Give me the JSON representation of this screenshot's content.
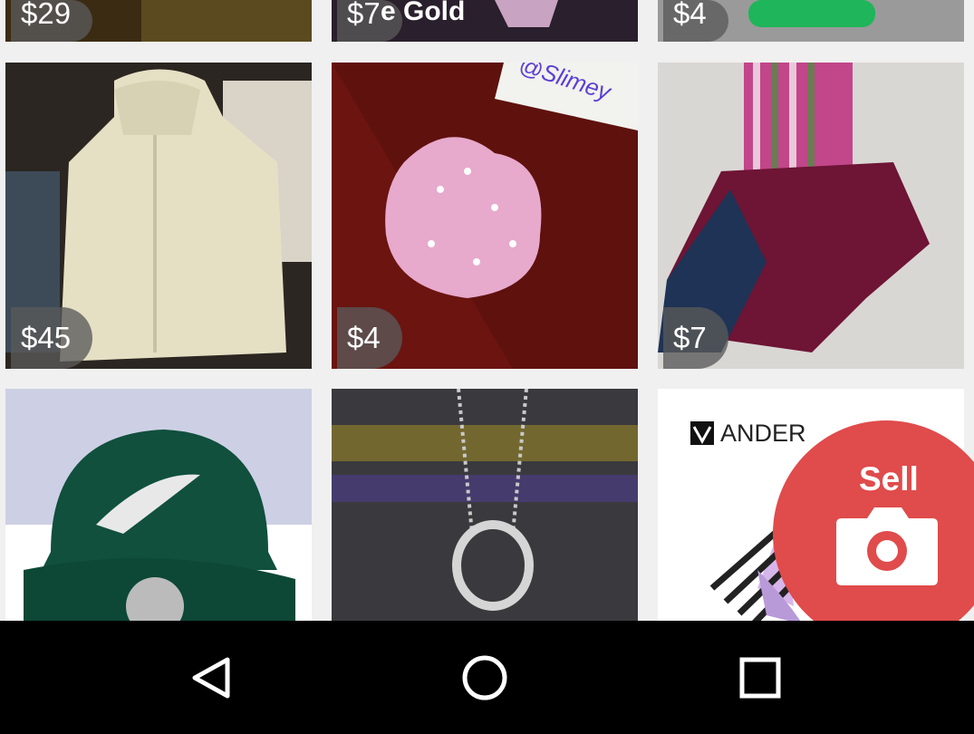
{
  "listings": [
    {
      "price": "$29"
    },
    {
      "price": "$7",
      "overlay": "e Gold"
    },
    {
      "price": "$4"
    },
    {
      "price": "$45"
    },
    {
      "price": "$4",
      "note": "@Slimey"
    },
    {
      "price": "$7"
    },
    {
      "price": ""
    },
    {
      "price": ""
    },
    {
      "price": "",
      "brand": "ANDER"
    }
  ],
  "fab": {
    "label": "Sell",
    "icon": "camera-icon",
    "color": "#e04b4b"
  },
  "navbar": {
    "back": "back-icon",
    "home": "home-icon",
    "recents": "recents-icon"
  }
}
